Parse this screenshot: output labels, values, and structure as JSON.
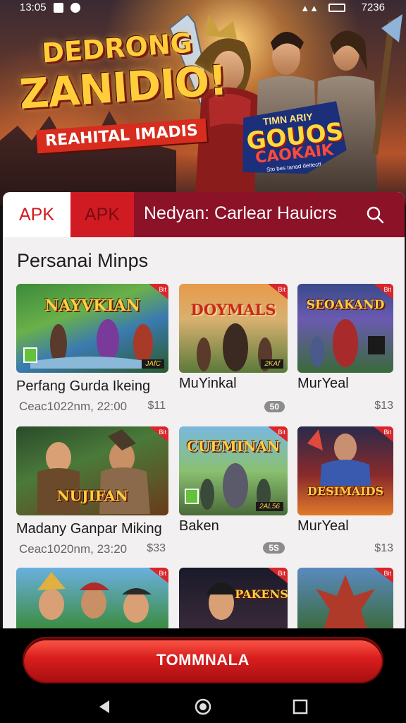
{
  "status_bar": {
    "time": "13:05",
    "right": "7236"
  },
  "hero": {
    "title_line1": "DEDRONG",
    "title_line2": "ZANIDIO!",
    "subtitle": "REAHITAL IMADIS",
    "badge_top": "TIMN ARIY",
    "badge_main": "GOUOS!",
    "badge_sub": "CAOKAIK",
    "badge_small": "Sto bes tanad dettectt"
  },
  "tabs": {
    "tab1": "APK",
    "tab2": "APK",
    "title": "Nedyan: Carlear Hauicrs"
  },
  "section": {
    "title": "Persanai Minps"
  },
  "cards": [
    {
      "name": "Perfang Gurda Ikeing",
      "meta": "Ceac1022nm, 22:00",
      "price": "$11",
      "logo": "NAYVKIAN",
      "corner": "Bit",
      "tag": "JAfC"
    },
    {
      "name": "MuYinkal",
      "meta": "",
      "price": "",
      "pill": "50",
      "logo": "DOYMALS",
      "corner": "Bit",
      "tag": "2KAf"
    },
    {
      "name": "MurYeal",
      "meta": "",
      "price": "$13",
      "logo": "SEOAKAND",
      "corner": "Bit",
      "tag": ""
    },
    {
      "name": "Madany Ganpar Miking",
      "meta": "Ceac1020nm, 23:20",
      "price": "$33",
      "logo": "NUJIFAN",
      "corner": "Bit",
      "tag": ""
    },
    {
      "name": "Baken",
      "meta": "",
      "price": "",
      "pill": "5S",
      "logo": "CUEMINAN",
      "corner": "Bit",
      "tag": "2AL56"
    },
    {
      "name": "MurYeal",
      "meta": "",
      "price": "$13",
      "logo": "DESIMAIDS",
      "corner": "Bit",
      "tag": ""
    },
    {
      "name": "",
      "meta": "",
      "price": "",
      "logo": "",
      "corner": "Bit",
      "tag": ""
    },
    {
      "name": "",
      "meta": "",
      "price": "",
      "logo": "PAKENS",
      "corner": "Bit",
      "tag": ""
    },
    {
      "name": "",
      "meta": "",
      "price": "",
      "logo": "",
      "corner": "Bit",
      "tag": ""
    }
  ],
  "cta": {
    "label": "TOMMNALA"
  },
  "nav_icons": [
    "back-icon",
    "home-icon",
    "recents-icon"
  ],
  "colors": {
    "accent": "#d11b22",
    "tabbar": "#8c1228",
    "sheet": "#f2f0f1"
  }
}
